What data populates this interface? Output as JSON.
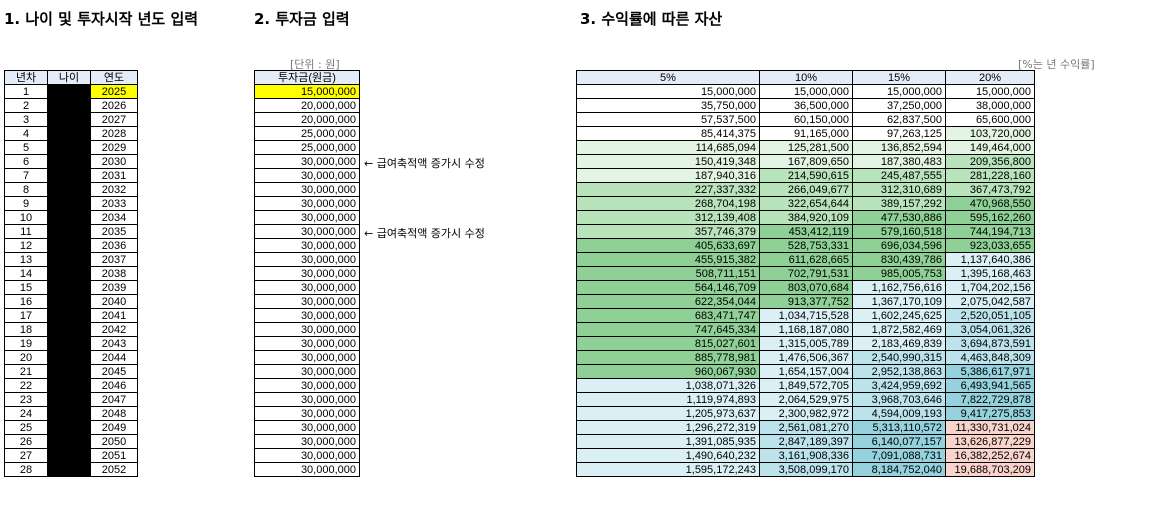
{
  "titles": {
    "section1": "1. 나이 및 투자시작 년도 입력",
    "section2": "2. 투자금 입력",
    "section3": "3. 수익률에 따른 자산"
  },
  "units": {
    "won": "[단위 : 원]",
    "percent": "[%는 년 수익률]"
  },
  "table1": {
    "headers": [
      "년차",
      "나이",
      "연도"
    ],
    "rows": [
      [
        "1",
        "",
        "2025"
      ],
      [
        "2",
        "",
        "2026"
      ],
      [
        "3",
        "",
        "2027"
      ],
      [
        "4",
        "",
        "2028"
      ],
      [
        "5",
        "",
        "2029"
      ],
      [
        "6",
        "",
        "2030"
      ],
      [
        "7",
        "",
        "2031"
      ],
      [
        "8",
        "",
        "2032"
      ],
      [
        "9",
        "",
        "2033"
      ],
      [
        "10",
        "",
        "2034"
      ],
      [
        "11",
        "",
        "2035"
      ],
      [
        "12",
        "",
        "2036"
      ],
      [
        "13",
        "",
        "2037"
      ],
      [
        "14",
        "",
        "2038"
      ],
      [
        "15",
        "",
        "2039"
      ],
      [
        "16",
        "",
        "2040"
      ],
      [
        "17",
        "",
        "2041"
      ],
      [
        "18",
        "",
        "2042"
      ],
      [
        "19",
        "",
        "2043"
      ],
      [
        "20",
        "",
        "2044"
      ],
      [
        "21",
        "",
        "2045"
      ],
      [
        "22",
        "",
        "2046"
      ],
      [
        "23",
        "",
        "2047"
      ],
      [
        "24",
        "",
        "2048"
      ],
      [
        "25",
        "",
        "2049"
      ],
      [
        "26",
        "",
        "2050"
      ],
      [
        "27",
        "",
        "2051"
      ],
      [
        "28",
        "",
        "2052"
      ]
    ]
  },
  "table2": {
    "header": "투자금(원금)",
    "rows": [
      "15,000,000",
      "20,000,000",
      "20,000,000",
      "25,000,000",
      "25,000,000",
      "30,000,000",
      "30,000,000",
      "30,000,000",
      "30,000,000",
      "30,000,000",
      "30,000,000",
      "30,000,000",
      "30,000,000",
      "30,000,000",
      "30,000,000",
      "30,000,000",
      "30,000,000",
      "30,000,000",
      "30,000,000",
      "30,000,000",
      "30,000,000",
      "30,000,000",
      "30,000,000",
      "30,000,000",
      "30,000,000",
      "30,000,000",
      "30,000,000",
      "30,000,000"
    ]
  },
  "notes": [
    {
      "row": 5,
      "text": "← 급여축적액 증가시 수정"
    },
    {
      "row": 10,
      "text": "← 급여축적액 증가시 수정"
    }
  ],
  "table3": {
    "headers": [
      "5%",
      "10%",
      "15%",
      "20%"
    ],
    "rows": [
      [
        "15,000,000",
        "15,000,000",
        "15,000,000",
        "15,000,000"
      ],
      [
        "35,750,000",
        "36,500,000",
        "37,250,000",
        "38,000,000"
      ],
      [
        "57,537,500",
        "60,150,000",
        "62,837,500",
        "65,600,000"
      ],
      [
        "85,414,375",
        "91,165,000",
        "97,263,125",
        "103,720,000"
      ],
      [
        "114,685,094",
        "125,281,500",
        "136,852,594",
        "149,464,000"
      ],
      [
        "150,419,348",
        "167,809,650",
        "187,380,483",
        "209,356,800"
      ],
      [
        "187,940,316",
        "214,590,615",
        "245,487,555",
        "281,228,160"
      ],
      [
        "227,337,332",
        "266,049,677",
        "312,310,689",
        "367,473,792"
      ],
      [
        "268,704,198",
        "322,654,644",
        "389,157,292",
        "470,968,550"
      ],
      [
        "312,139,408",
        "384,920,109",
        "477,530,886",
        "595,162,260"
      ],
      [
        "357,746,379",
        "453,412,119",
        "579,160,518",
        "744,194,713"
      ],
      [
        "405,633,697",
        "528,753,331",
        "696,034,596",
        "923,033,655"
      ],
      [
        "455,915,382",
        "611,628,665",
        "830,439,786",
        "1,137,640,386"
      ],
      [
        "508,711,151",
        "702,791,531",
        "985,005,753",
        "1,395,168,463"
      ],
      [
        "564,146,709",
        "803,070,684",
        "1,162,756,616",
        "1,704,202,156"
      ],
      [
        "622,354,044",
        "913,377,752",
        "1,367,170,109",
        "2,075,042,587"
      ],
      [
        "683,471,747",
        "1,034,715,528",
        "1,602,245,625",
        "2,520,051,105"
      ],
      [
        "747,645,334",
        "1,168,187,080",
        "1,872,582,469",
        "3,054,061,326"
      ],
      [
        "815,027,601",
        "1,315,005,789",
        "2,183,469,839",
        "3,694,873,591"
      ],
      [
        "885,778,981",
        "1,476,506,367",
        "2,540,990,315",
        "4,463,848,309"
      ],
      [
        "960,067,930",
        "1,654,157,004",
        "2,952,138,863",
        "5,386,617,971"
      ],
      [
        "1,038,071,326",
        "1,849,572,705",
        "3,424,959,692",
        "6,493,941,565"
      ],
      [
        "1,119,974,893",
        "2,064,529,975",
        "3,968,703,646",
        "7,822,729,878"
      ],
      [
        "1,205,973,637",
        "2,300,982,972",
        "4,594,009,193",
        "9,417,275,853"
      ],
      [
        "1,296,272,319",
        "2,561,081,270",
        "5,313,110,572",
        "11,330,731,024"
      ],
      [
        "1,391,085,935",
        "2,847,189,397",
        "6,140,077,157",
        "13,626,877,229"
      ],
      [
        "1,490,640,232",
        "3,161,908,336",
        "7,091,088,731",
        "16,382,252,674"
      ],
      [
        "1,595,172,243",
        "3,508,099,170",
        "8,184,752,040",
        "19,688,703,209"
      ]
    ]
  },
  "colors": {
    "yellow": "#ffff00",
    "header_bg": "#e4ecf7",
    "white": "#ffffff",
    "green_light": "#e3f4e3",
    "green_mid": "#b8e3bb",
    "green_dark": "#8fd096",
    "cyan_light": "#dbf0f4",
    "cyan_mid": "#bce3ec",
    "cyan_dark": "#96d2de",
    "pink": "#f8d4cc"
  }
}
